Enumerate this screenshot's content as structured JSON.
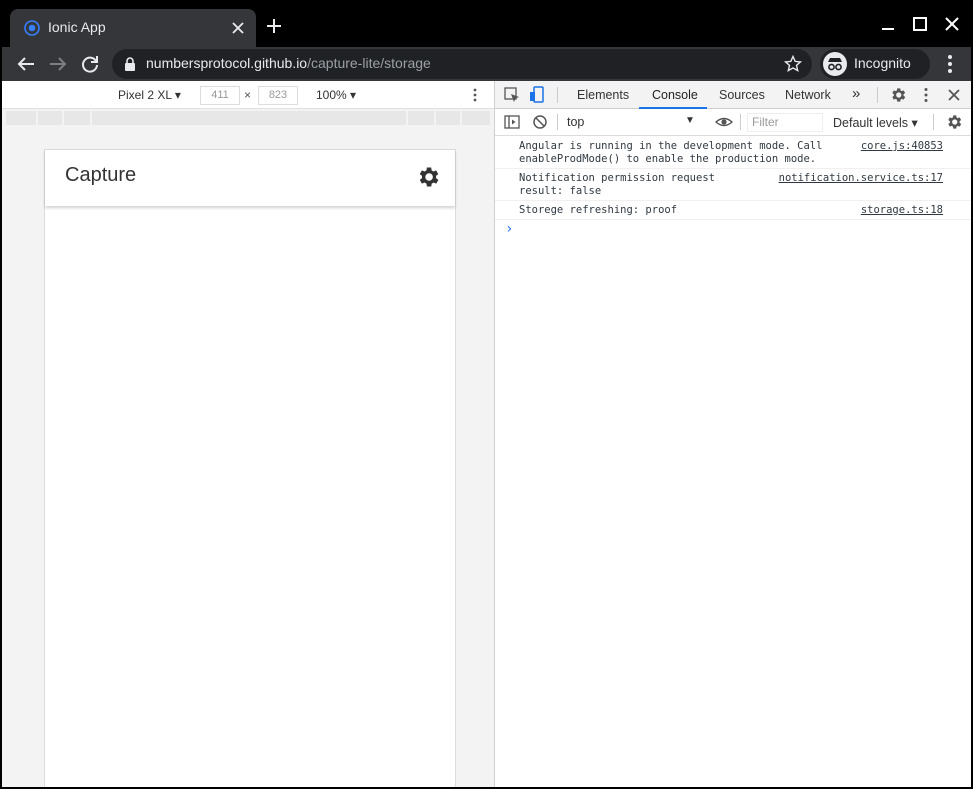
{
  "browser": {
    "tab_title": "Ionic App",
    "url_host": "numbersprotocol.github.io",
    "url_path": "/capture-lite/storage",
    "incognito_label": "Incognito"
  },
  "device_toolbar": {
    "device": "Pixel 2 XL",
    "width": "411",
    "height": "823",
    "dim_separator": "×",
    "zoom": "100%"
  },
  "app": {
    "title": "Capture"
  },
  "devtools": {
    "tabs": [
      "Elements",
      "Console",
      "Sources",
      "Network"
    ],
    "more_tabs": "»",
    "context": "top",
    "filter_placeholder": "Filter",
    "levels": "Default levels",
    "console": [
      {
        "message": "Angular is running in the development mode. Call\nenableProdMode() to enable the production mode.",
        "source": "core.js:40853"
      },
      {
        "message": "Notification permission request\nresult: false",
        "source": "notification.service.ts:17"
      },
      {
        "message": "Storege refreshing: proof",
        "source": "storage.ts:18"
      }
    ],
    "prompt": "›"
  },
  "colors": {
    "chrome_dark": "#35363a",
    "accent_blue": "#1a73e8"
  }
}
